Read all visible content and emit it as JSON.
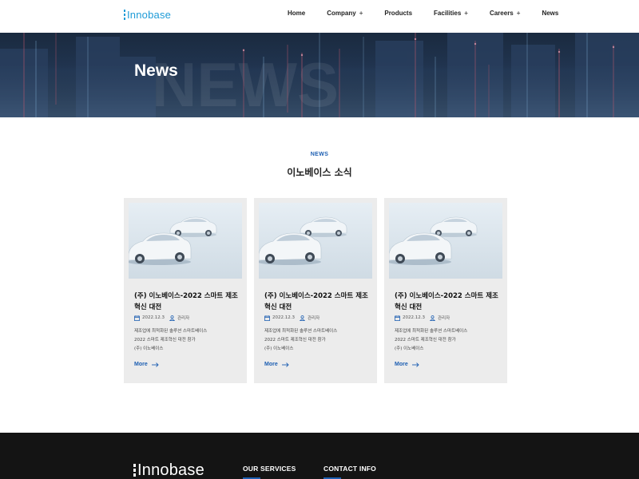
{
  "brand": {
    "logo_text": "Innobase",
    "accent": "#1e9bd7",
    "link_color": "#1d5fb2"
  },
  "nav": {
    "items": [
      {
        "label": "Home",
        "has_submenu": false
      },
      {
        "label": "Company",
        "has_submenu": true
      },
      {
        "label": "Products",
        "has_submenu": false
      },
      {
        "label": "Facilities",
        "has_submenu": true
      },
      {
        "label": "Careers",
        "has_submenu": true
      },
      {
        "label": "News",
        "has_submenu": false
      }
    ],
    "submenu_glyph": "+"
  },
  "banner": {
    "title": "News",
    "watermark": "NEWS"
  },
  "section": {
    "eyebrow": "NEWS",
    "title": "이노베이스 소식"
  },
  "cards": [
    {
      "title": "(주) 이노베이스-2022 스마트 제조혁신 대전",
      "date": "2022.12.3",
      "author": "관리자",
      "desc_lines": [
        "제조업에 최적화된 솔루션 스마트베이스",
        "2022 스마트 제조혁신 대전 참가",
        "(주) 이노베이스"
      ],
      "more": "More",
      "image": "white-cars-illustration"
    },
    {
      "title": "(주) 이노베이스-2022 스마트 제조혁신 대전",
      "date": "2022.12.3",
      "author": "관리자",
      "desc_lines": [
        "제조업에 최적화된 솔루션 스마트베이스",
        "2022 스마트 제조혁신 대전 참가",
        "(주) 이노베이스"
      ],
      "more": "More",
      "image": "white-cars-illustration"
    },
    {
      "title": "(주) 이노베이스-2022 스마트 제조혁신 대전",
      "date": "2022.12.3",
      "author": "관리자",
      "desc_lines": [
        "제조업에 최적화된 솔루션 스마트베이스",
        "2022 스마트 제조혁신 대전 참가",
        "(주) 이노베이스"
      ],
      "more": "More",
      "image": "white-cars-illustration"
    }
  ],
  "footer": {
    "logo_text": "Innobase",
    "headings": [
      "OUR SERVICES",
      "CONTACT INFO"
    ]
  }
}
